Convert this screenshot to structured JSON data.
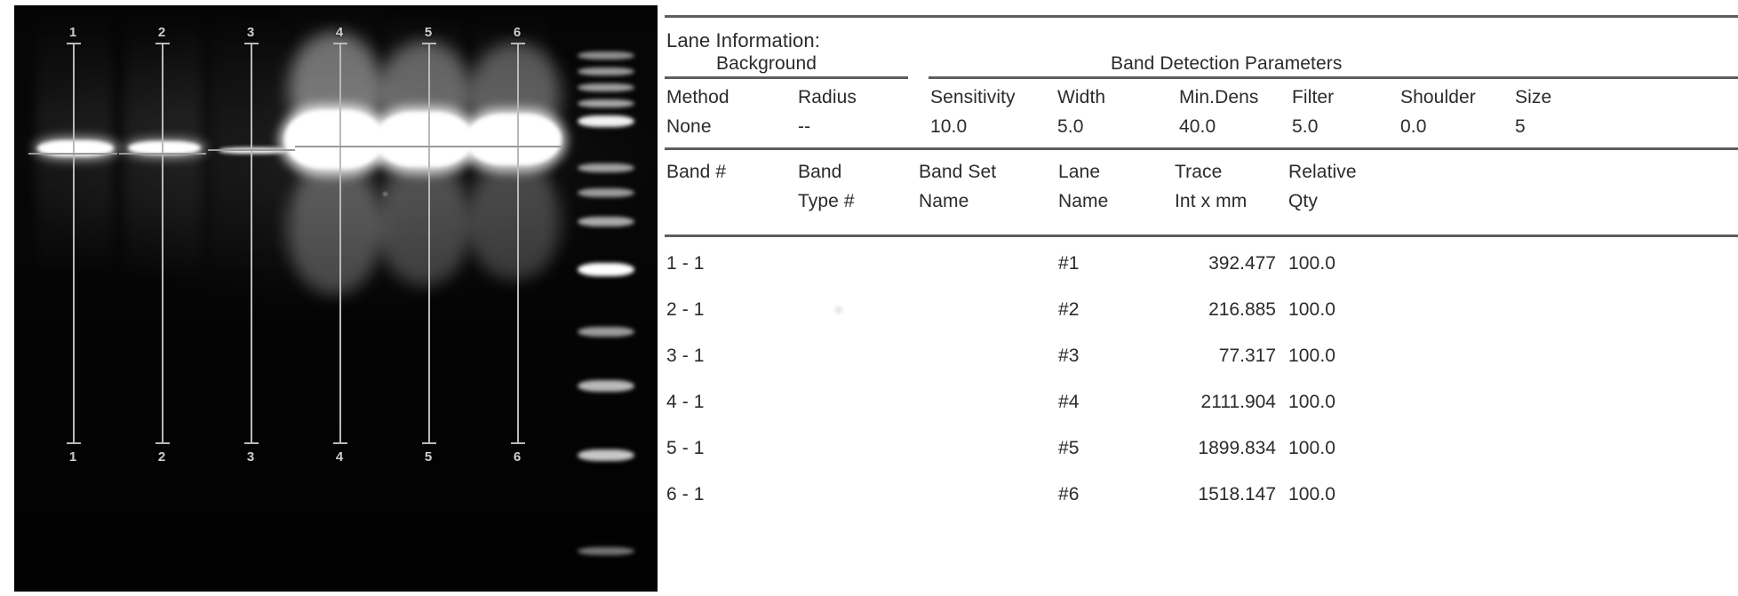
{
  "gel": {
    "lane_numbers_top": [
      "1",
      "2",
      "3",
      "4",
      "5",
      "6"
    ],
    "lane_numbers_bottom": [
      "1",
      "2",
      "3",
      "4",
      "5",
      "6"
    ],
    "ladder_label": ""
  },
  "report": {
    "title": "Lane Information:",
    "group_headers": {
      "background": "Background",
      "band_detection": "Band Detection Parameters"
    },
    "param_columns": [
      "Method",
      "Radius",
      "Sensitivity",
      "Width",
      "Min.Dens",
      "Filter",
      "Shoulder",
      "Size"
    ],
    "param_values": [
      "None",
      "--",
      "10.0",
      "5.0",
      "40.0",
      "5.0",
      "0.0",
      "5"
    ],
    "band_columns_line1": [
      "Band #",
      "Band",
      "Band Set",
      "Lane",
      "Trace",
      "Relative"
    ],
    "band_columns_line2": [
      "",
      "Type #",
      "Name",
      "Name",
      "Int x mm",
      "Qty"
    ],
    "rows": [
      {
        "band": "1 -  1",
        "band_type": "",
        "band_set": "",
        "lane_name": "#1",
        "trace": "392.477",
        "relative_qty": "100.0"
      },
      {
        "band": "2 -  1",
        "band_type": "",
        "band_set": "",
        "lane_name": "#2",
        "trace": "216.885",
        "relative_qty": "100.0"
      },
      {
        "band": "3 -  1",
        "band_type": "",
        "band_set": "",
        "lane_name": "#3",
        "trace": "77.317",
        "relative_qty": "100.0"
      },
      {
        "band": "4 -  1",
        "band_type": "",
        "band_set": "",
        "lane_name": "#4",
        "trace": "2111.904",
        "relative_qty": "100.0"
      },
      {
        "band": "5 -  1",
        "band_type": "",
        "band_set": "",
        "lane_name": "#5",
        "trace": "1899.834",
        "relative_qty": "100.0"
      },
      {
        "band": "6 -  1",
        "band_type": "",
        "band_set": "",
        "lane_name": "#6",
        "trace": "1518.147",
        "relative_qty": "100.0"
      }
    ]
  },
  "colors": {
    "page_bg": "#ffffff",
    "gel_bg": "#000000",
    "text": "#2b2b2b",
    "rule": "#5e5e5e",
    "overlay_line": "#b9b9b9"
  }
}
